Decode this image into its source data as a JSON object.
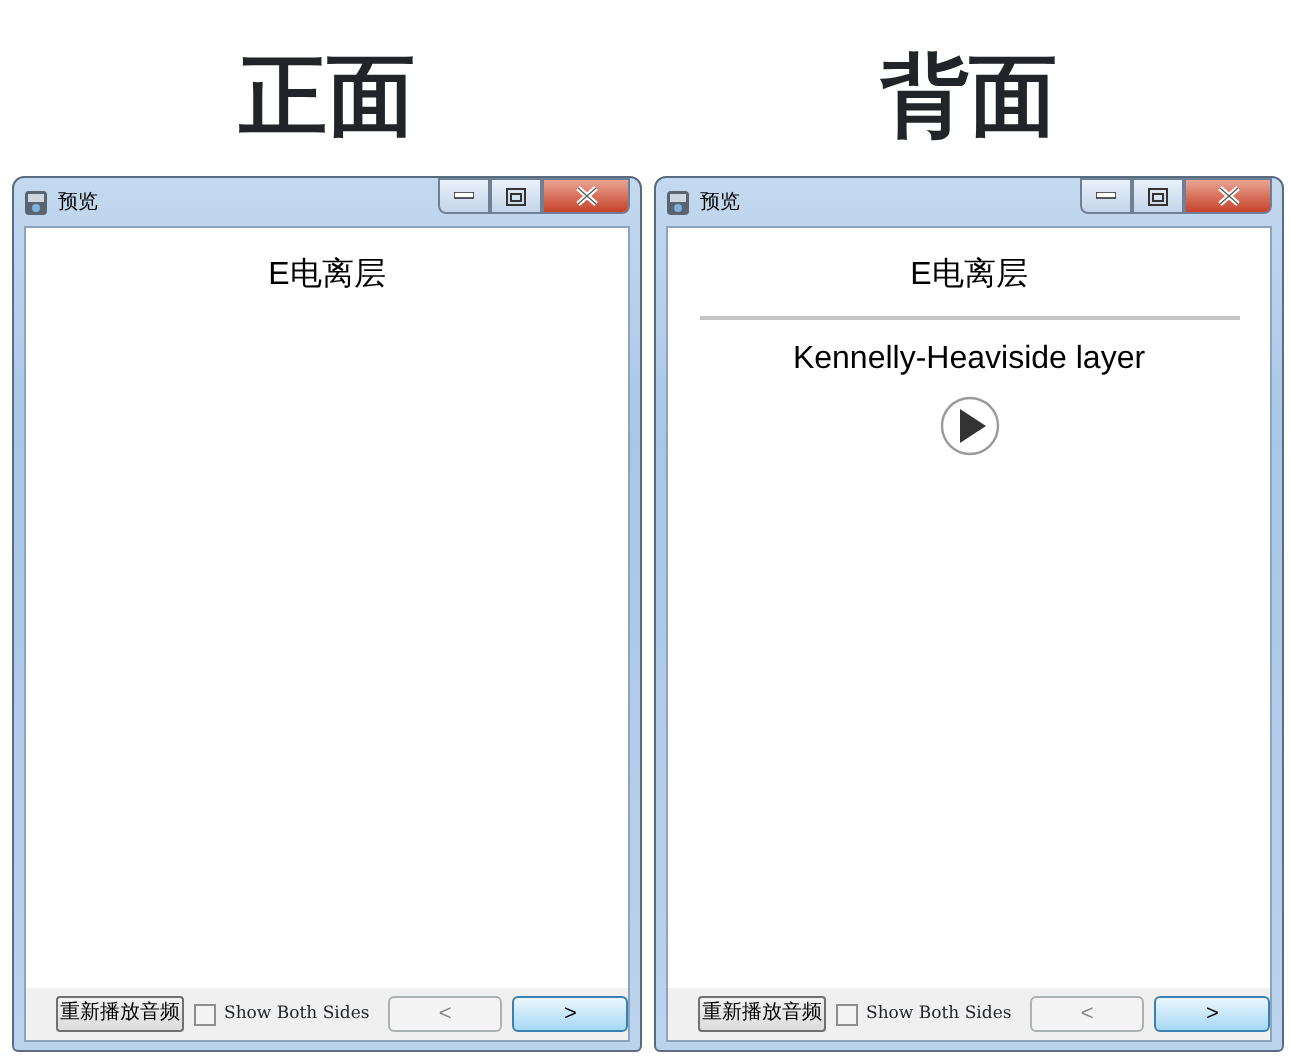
{
  "panels": [
    {
      "heading": "正面",
      "window": {
        "title": "预览",
        "content": [
          {
            "kind": "text",
            "text": "E电离层"
          }
        ],
        "replay_button": "重新播放音频",
        "show_both_sides": {
          "label": "Show Both Sides",
          "checked": false
        },
        "prev_button": {
          "label": "<",
          "disabled": true
        },
        "next_button": {
          "label": ">",
          "focused": true
        }
      }
    },
    {
      "heading": "背面",
      "window": {
        "title": "预览",
        "content": [
          {
            "kind": "text",
            "text": "E电离层"
          },
          {
            "kind": "divider"
          },
          {
            "kind": "text",
            "text": "Kennelly-Heaviside layer"
          },
          {
            "kind": "audio"
          }
        ],
        "replay_button": "重新播放音频",
        "show_both_sides": {
          "label": "Show Both Sides",
          "checked": false
        },
        "prev_button": {
          "label": "<",
          "disabled": true
        },
        "next_button": {
          "label": ">",
          "focused": true
        }
      }
    }
  ]
}
